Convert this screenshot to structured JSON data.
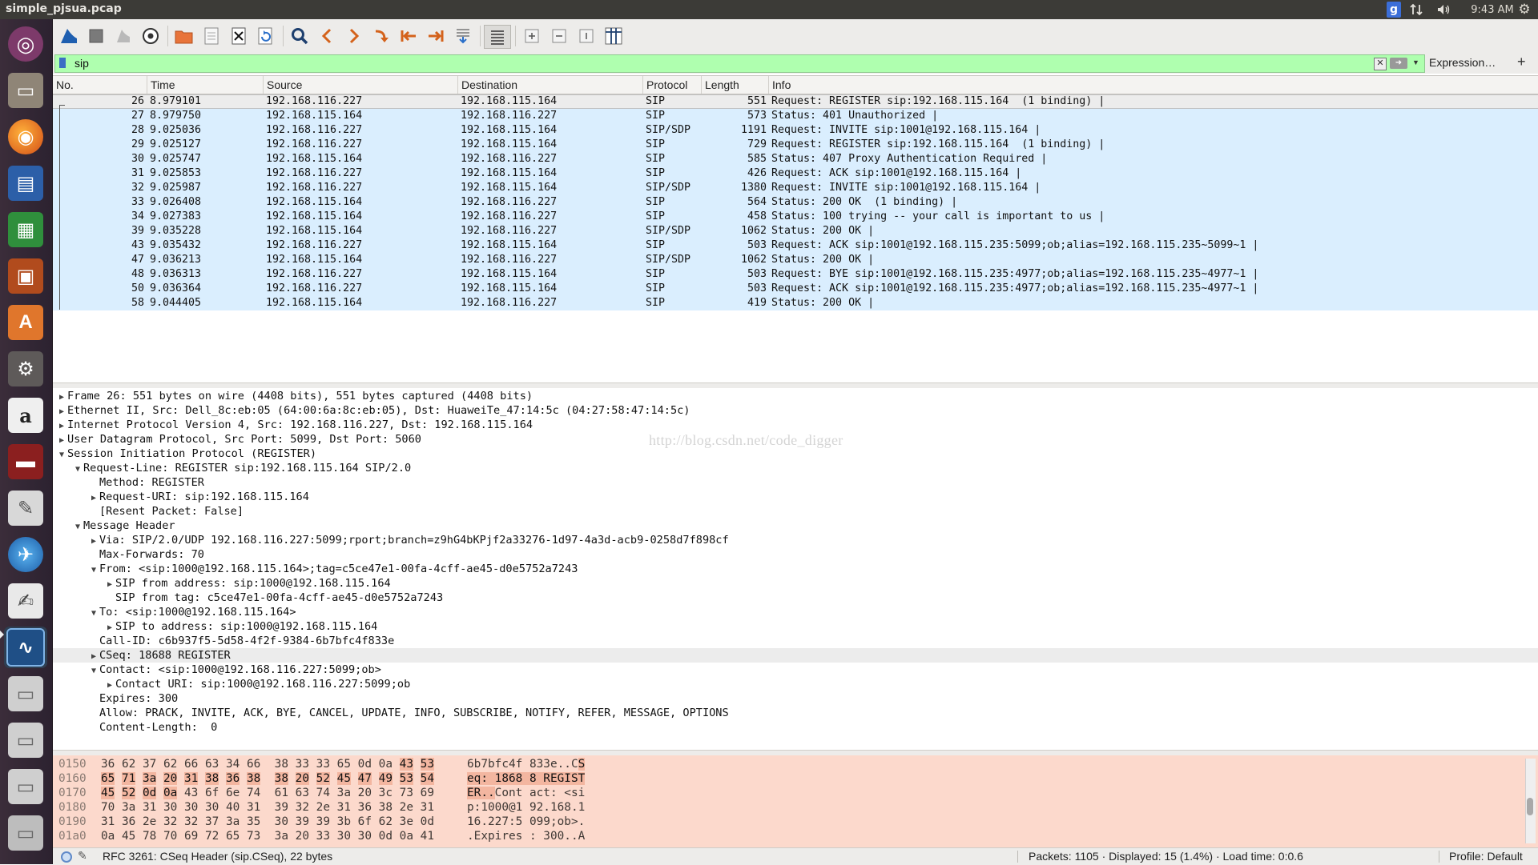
{
  "window": {
    "title": "simple_pjsua.pcap"
  },
  "system": {
    "indicator_g": "g",
    "clock": "9:43 AM"
  },
  "filter": {
    "value": "sip",
    "expression_label": "Expression…",
    "add_label": "+"
  },
  "columns": [
    "No.",
    "Time",
    "Source",
    "Destination",
    "Protocol",
    "Length",
    "Info"
  ],
  "packets": [
    {
      "no": "26",
      "time": "8.979101",
      "src": "192.168.116.227",
      "dst": "192.168.115.164",
      "proto": "SIP",
      "len": "551",
      "info": "Request: REGISTER sip:192.168.115.164  (1 binding) |"
    },
    {
      "no": "27",
      "time": "8.979750",
      "src": "192.168.115.164",
      "dst": "192.168.116.227",
      "proto": "SIP",
      "len": "573",
      "info": "Status: 401 Unauthorized |"
    },
    {
      "no": "28",
      "time": "9.025036",
      "src": "192.168.116.227",
      "dst": "192.168.115.164",
      "proto": "SIP/SDP",
      "len": "1191",
      "info": "Request: INVITE sip:1001@192.168.115.164 |"
    },
    {
      "no": "29",
      "time": "9.025127",
      "src": "192.168.116.227",
      "dst": "192.168.115.164",
      "proto": "SIP",
      "len": "729",
      "info": "Request: REGISTER sip:192.168.115.164  (1 binding) |"
    },
    {
      "no": "30",
      "time": "9.025747",
      "src": "192.168.115.164",
      "dst": "192.168.116.227",
      "proto": "SIP",
      "len": "585",
      "info": "Status: 407 Proxy Authentication Required |"
    },
    {
      "no": "31",
      "time": "9.025853",
      "src": "192.168.116.227",
      "dst": "192.168.115.164",
      "proto": "SIP",
      "len": "426",
      "info": "Request: ACK sip:1001@192.168.115.164 |"
    },
    {
      "no": "32",
      "time": "9.025987",
      "src": "192.168.116.227",
      "dst": "192.168.115.164",
      "proto": "SIP/SDP",
      "len": "1380",
      "info": "Request: INVITE sip:1001@192.168.115.164 |"
    },
    {
      "no": "33",
      "time": "9.026408",
      "src": "192.168.115.164",
      "dst": "192.168.116.227",
      "proto": "SIP",
      "len": "564",
      "info": "Status: 200 OK  (1 binding) |"
    },
    {
      "no": "34",
      "time": "9.027383",
      "src": "192.168.115.164",
      "dst": "192.168.116.227",
      "proto": "SIP",
      "len": "458",
      "info": "Status: 100 trying -- your call is important to us |"
    },
    {
      "no": "39",
      "time": "9.035228",
      "src": "192.168.115.164",
      "dst": "192.168.116.227",
      "proto": "SIP/SDP",
      "len": "1062",
      "info": "Status: 200 OK |"
    },
    {
      "no": "43",
      "time": "9.035432",
      "src": "192.168.116.227",
      "dst": "192.168.115.164",
      "proto": "SIP",
      "len": "503",
      "info": "Request: ACK sip:1001@192.168.115.235:5099;ob;alias=192.168.115.235~5099~1 |"
    },
    {
      "no": "47",
      "time": "9.036213",
      "src": "192.168.115.164",
      "dst": "192.168.116.227",
      "proto": "SIP/SDP",
      "len": "1062",
      "info": "Status: 200 OK |"
    },
    {
      "no": "48",
      "time": "9.036313",
      "src": "192.168.116.227",
      "dst": "192.168.115.164",
      "proto": "SIP",
      "len": "503",
      "info": "Request: BYE sip:1001@192.168.115.235:4977;ob;alias=192.168.115.235~4977~1 |"
    },
    {
      "no": "50",
      "time": "9.036364",
      "src": "192.168.116.227",
      "dst": "192.168.115.164",
      "proto": "SIP",
      "len": "503",
      "info": "Request: ACK sip:1001@192.168.115.235:4977;ob;alias=192.168.115.235~4977~1 |"
    },
    {
      "no": "58",
      "time": "9.044405",
      "src": "192.168.115.164",
      "dst": "192.168.116.227",
      "proto": "SIP",
      "len": "419",
      "info": "Status: 200 OK |"
    }
  ],
  "detail_tree": [
    {
      "depth": 0,
      "state": "collapsed",
      "text": "Frame 26: 551 bytes on wire (4408 bits), 551 bytes captured (4408 bits)"
    },
    {
      "depth": 0,
      "state": "collapsed",
      "text": "Ethernet II, Src: Dell_8c:eb:05 (64:00:6a:8c:eb:05), Dst: HuaweiTe_47:14:5c (04:27:58:47:14:5c)"
    },
    {
      "depth": 0,
      "state": "collapsed",
      "text": "Internet Protocol Version 4, Src: 192.168.116.227, Dst: 192.168.115.164"
    },
    {
      "depth": 0,
      "state": "collapsed",
      "text": "User Datagram Protocol, Src Port: 5099, Dst Port: 5060"
    },
    {
      "depth": 0,
      "state": "expanded",
      "text": "Session Initiation Protocol (REGISTER)"
    },
    {
      "depth": 1,
      "state": "expanded",
      "text": "Request-Line: REGISTER sip:192.168.115.164 SIP/2.0"
    },
    {
      "depth": 2,
      "state": "leaf",
      "text": "Method: REGISTER"
    },
    {
      "depth": 2,
      "state": "collapsed",
      "text": "Request-URI: sip:192.168.115.164"
    },
    {
      "depth": 2,
      "state": "leaf",
      "text": "[Resent Packet: False]"
    },
    {
      "depth": 1,
      "state": "expanded",
      "text": "Message Header"
    },
    {
      "depth": 2,
      "state": "collapsed",
      "text": "Via: SIP/2.0/UDP 192.168.116.227:5099;rport;branch=z9hG4bKPjf2a33276-1d97-4a3d-acb9-0258d7f898cf"
    },
    {
      "depth": 2,
      "state": "leaf",
      "text": "Max-Forwards: 70"
    },
    {
      "depth": 2,
      "state": "expanded",
      "text": "From: <sip:1000@192.168.115.164>;tag=c5ce47e1-00fa-4cff-ae45-d0e5752a7243"
    },
    {
      "depth": 3,
      "state": "collapsed",
      "text": "SIP from address: sip:1000@192.168.115.164"
    },
    {
      "depth": 3,
      "state": "leaf",
      "text": "SIP from tag: c5ce47e1-00fa-4cff-ae45-d0e5752a7243"
    },
    {
      "depth": 2,
      "state": "expanded",
      "text": "To: <sip:1000@192.168.115.164>"
    },
    {
      "depth": 3,
      "state": "collapsed",
      "text": "SIP to address: sip:1000@192.168.115.164"
    },
    {
      "depth": 2,
      "state": "leaf",
      "text": "Call-ID: c6b937f5-5d58-4f2f-9384-6b7bfc4f833e"
    },
    {
      "depth": 2,
      "state": "collapsed",
      "text": "CSeq: 18688 REGISTER",
      "highlight": true
    },
    {
      "depth": 2,
      "state": "expanded",
      "text": "Contact: <sip:1000@192.168.116.227:5099;ob>"
    },
    {
      "depth": 3,
      "state": "collapsed",
      "text": "Contact URI: sip:1000@192.168.116.227:5099;ob"
    },
    {
      "depth": 2,
      "state": "leaf",
      "text": "Expires: 300"
    },
    {
      "depth": 2,
      "state": "leaf",
      "text": "Allow: PRACK, INVITE, ACK, BYE, CANCEL, UPDATE, INFO, SUBSCRIBE, NOTIFY, REFER, MESSAGE, OPTIONS"
    },
    {
      "depth": 2,
      "state": "leaf",
      "text": "Content-Length:  0"
    }
  ],
  "watermark": "http://blog.csdn.net/code_digger",
  "bytes": [
    {
      "offset": "0150",
      "hex": [
        "36",
        "62",
        "37",
        "62",
        "66",
        "63",
        "34",
        "66",
        "38",
        "33",
        "33",
        "65",
        "0d",
        "0a",
        "43",
        "53"
      ],
      "ascii": "6b7bfc4f 833e..CS",
      "hl_from": 14,
      "hl_to": 16,
      "asc_hl_from": 16
    },
    {
      "offset": "0160",
      "hex": [
        "65",
        "71",
        "3a",
        "20",
        "31",
        "38",
        "36",
        "38",
        "38",
        "20",
        "52",
        "45",
        "47",
        "49",
        "53",
        "54"
      ],
      "ascii": "eq: 1868 8 REGIST",
      "hl_from": 0,
      "hl_to": 16,
      "asc_hl_from": 0
    },
    {
      "offset": "0170",
      "hex": [
        "45",
        "52",
        "0d",
        "0a",
        "43",
        "6f",
        "6e",
        "74",
        "61",
        "63",
        "74",
        "3a",
        "20",
        "3c",
        "73",
        "69"
      ],
      "ascii": "ER..Cont act: <si",
      "hl_from": 0,
      "hl_to": 4,
      "asc_hl_to": 4
    },
    {
      "offset": "0180",
      "hex": [
        "70",
        "3a",
        "31",
        "30",
        "30",
        "30",
        "40",
        "31",
        "39",
        "32",
        "2e",
        "31",
        "36",
        "38",
        "2e",
        "31"
      ],
      "ascii": "p:1000@1 92.168.1"
    },
    {
      "offset": "0190",
      "hex": [
        "31",
        "36",
        "2e",
        "32",
        "32",
        "37",
        "3a",
        "35",
        "30",
        "39",
        "39",
        "3b",
        "6f",
        "62",
        "3e",
        "0d"
      ],
      "ascii": "16.227:5 099;ob>."
    },
    {
      "offset": "01a0",
      "hex": [
        "0a",
        "45",
        "78",
        "70",
        "69",
        "72",
        "65",
        "73",
        "3a",
        "20",
        "33",
        "30",
        "30",
        "0d",
        "0a",
        "41"
      ],
      "ascii": ".Expires : 300..A"
    }
  ],
  "status": {
    "field_info": "RFC 3261: CSeq Header (sip.CSeq), 22 bytes",
    "packets": "Packets: 1105 · Displayed: 15 (1.4%) · Load time: 0:0.6",
    "profile": "Profile: Default"
  },
  "launcher_items": [
    "ubuntu-dash",
    "files",
    "firefox",
    "writer",
    "calc",
    "impress",
    "software-center",
    "system-settings",
    "amazon",
    "screen-recorder",
    "text-editor",
    "browser",
    "gedit",
    "wireshark",
    "disk-1",
    "disk-2",
    "disk-3",
    "disk-4"
  ]
}
